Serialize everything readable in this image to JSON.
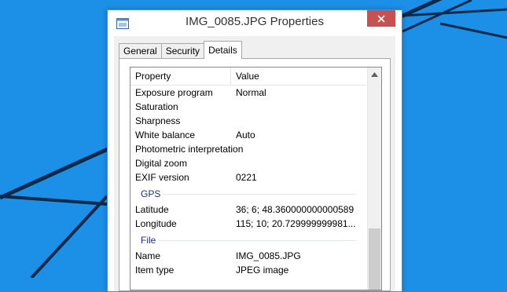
{
  "window": {
    "title": "IMG_0085.JPG Properties"
  },
  "tabs": [
    {
      "label": "General",
      "active": false
    },
    {
      "label": "Security",
      "active": false
    },
    {
      "label": "Details",
      "active": true
    }
  ],
  "list": {
    "header": {
      "property": "Property",
      "value": "Value"
    },
    "rows": [
      {
        "property": "Exposure program",
        "value": "Normal"
      },
      {
        "property": "Saturation",
        "value": ""
      },
      {
        "property": "Sharpness",
        "value": ""
      },
      {
        "property": "White balance",
        "value": "Auto"
      },
      {
        "property": "Photometric interpretation",
        "value": ""
      },
      {
        "property": "Digital zoom",
        "value": ""
      },
      {
        "property": "EXIF version",
        "value": "0221"
      }
    ],
    "gps_group": "GPS",
    "gps_rows": [
      {
        "property": "Latitude",
        "value": "36; 6; 48.360000000000589"
      },
      {
        "property": "Longitude",
        "value": "115; 10; 20.729999999981..."
      }
    ],
    "file_group": "File",
    "file_rows": [
      {
        "property": "Name",
        "value": "IMG_0085.JPG"
      },
      {
        "property": "Item type",
        "value": "JPEG image"
      }
    ]
  },
  "icons": {
    "app": "properties-window-icon",
    "close": "close-icon",
    "scroll_up": "chevron-up-icon"
  },
  "colors": {
    "desktop": "#1c8fe6",
    "close_button": "#c75050",
    "group_header": "#1e3287"
  }
}
